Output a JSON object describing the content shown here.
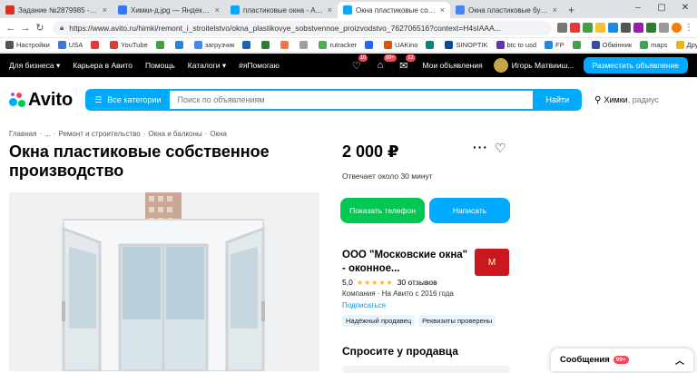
{
  "browser": {
    "tabs": [
      {
        "label": "Задание №2879985 - просмо",
        "icon": "sp-icon",
        "color": "#d93025",
        "active": false
      },
      {
        "label": "Химки-д.jpg — Яндекс Диск",
        "icon": "yandex-disk-icon",
        "color": "#3377ff",
        "active": false
      },
      {
        "label": "пластиковые окна - Авито | С",
        "icon": "avito-icon",
        "color": "#00aaff",
        "active": false
      },
      {
        "label": "Окна пластиковые собственное",
        "icon": "avito-icon",
        "color": "#00aaff",
        "active": true
      },
      {
        "label": "Окна пластиковые бу купить",
        "icon": "loading-icon",
        "color": "#4285f4",
        "active": false
      }
    ],
    "url": "https://www.avito.ru/himki/remont_i_stroitelstvo/okna_plastikovye_sobstvennoe_proizvodstvo_762706516?context=H4sIAAA...",
    "bookmarks": [
      "Настройки",
      "USA",
      "",
      "YouTube",
      "",
      "",
      "загрузчик",
      "",
      "",
      "",
      "",
      "rutracker",
      "",
      "UAKino",
      "",
      "SINOPTIK",
      "btc to usd",
      "FP",
      "",
      "Обмінник",
      "maps"
    ],
    "bookmarks_other": "Другие закладки"
  },
  "topbar": {
    "for_business": "Для бизнеса",
    "career": "Карьера в Авито",
    "help": "Помощь",
    "catalogs": "Каталоги",
    "ipomogayu": "#яПомогаю",
    "badges": [
      "10",
      "99+",
      "12"
    ],
    "my_ads": "Мои объявления",
    "user": "Игорь Матвииш...",
    "post_button": "Разместить объявление"
  },
  "search": {
    "logo": "Avito",
    "categories": "Все категории",
    "placeholder": "Поиск по объявлениям",
    "find": "Найти",
    "city": "Химки",
    "radius": ", радиус"
  },
  "breadcrumb": [
    "Главная",
    "·",
    "...",
    "·",
    "Ремонт и строительство",
    "·",
    "Окна и балконы",
    "·",
    "Окна"
  ],
  "listing": {
    "title": "Окна пластиковые собственное производство",
    "price": "2 000 ₽",
    "replies": "Отвечает около 30 минут",
    "show_phone": "Показать телефон",
    "write": "Написать"
  },
  "seller": {
    "name": "ООО \"Московские окна\" - оконное...",
    "logo_text": "М",
    "rating": "5,0",
    "stars": "★★★★★",
    "reviews": "30 отзывов",
    "company": "Компания · На Авито с 2016 года",
    "subscribe": "Подписаться",
    "tags": [
      "Надёжный продавец",
      "Реквизиты проверены"
    ]
  },
  "ask_seller": "Спросите у продавца",
  "messages": {
    "label": "Сообщения",
    "badge": "99+"
  }
}
